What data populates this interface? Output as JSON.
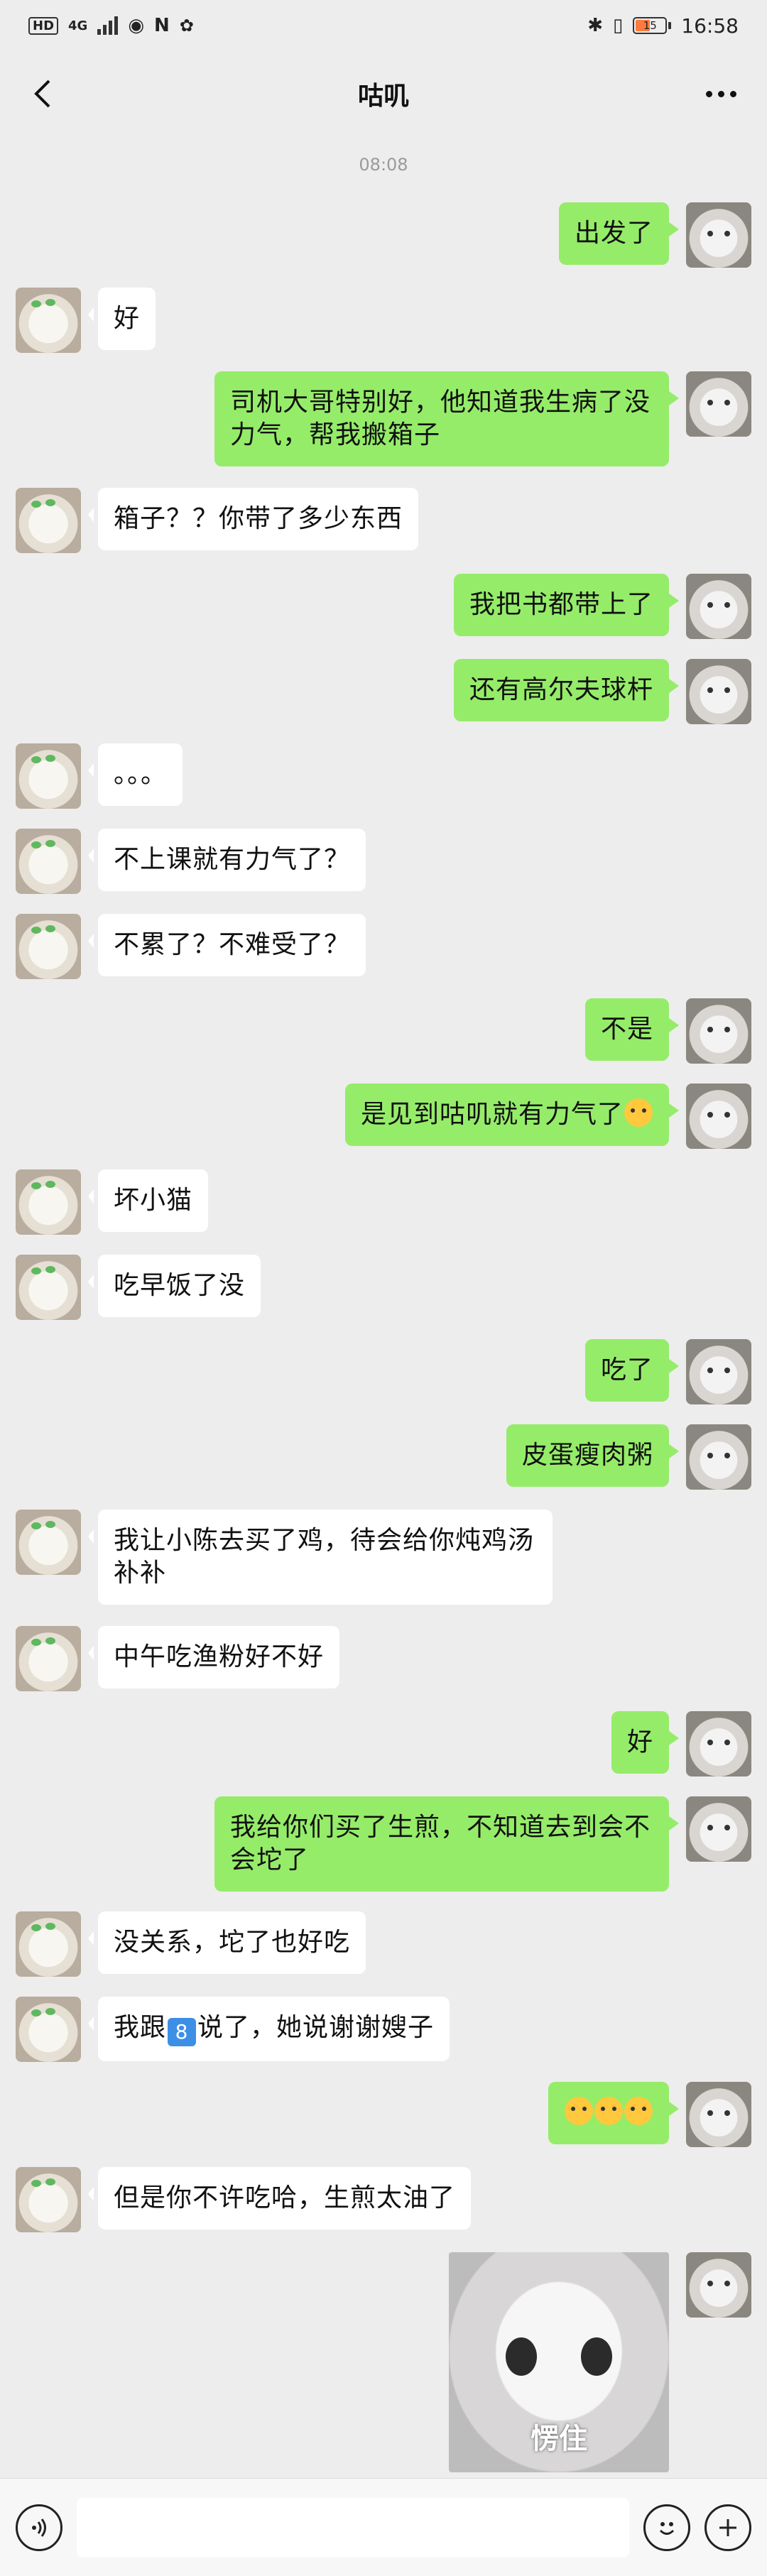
{
  "status_bar": {
    "network": "HD",
    "signal_label": "4G",
    "time": "16:58",
    "battery": "15"
  },
  "header": {
    "back_icon": "chevron-left-icon",
    "title": "咕叽",
    "more_icon": "more-dots-icon"
  },
  "timestamp": "08:08",
  "messages": [
    {
      "from": "self",
      "text": "出发了"
    },
    {
      "from": "other",
      "text": "好"
    },
    {
      "from": "self",
      "text": "司机大哥特别好，他知道我生病了没力气，帮我搬箱子"
    },
    {
      "from": "other",
      "text": "箱子？？你带了多少东西"
    },
    {
      "from": "self",
      "text": "我把书都带上了"
    },
    {
      "from": "self",
      "text": "还有高尔夫球杆"
    },
    {
      "from": "other",
      "text": "。。。"
    },
    {
      "from": "other",
      "text": "不上课就有力气了？"
    },
    {
      "from": "other",
      "text": "不累了？不难受了？"
    },
    {
      "from": "self",
      "text": "不是"
    },
    {
      "from": "self",
      "text": "是见到咕叽就有力气了"
    },
    {
      "from": "other",
      "text": "坏小猫"
    },
    {
      "from": "other",
      "text": "吃早饭了没"
    },
    {
      "from": "self",
      "text": "吃了"
    },
    {
      "from": "self",
      "text": "皮蛋瘦肉粥"
    },
    {
      "from": "other",
      "text": "我让小陈去买了鸡，待会给你炖鸡汤补补"
    },
    {
      "from": "other",
      "text": "中午吃渔粉好不好"
    },
    {
      "from": "self",
      "text": "好"
    },
    {
      "from": "self",
      "text": "我给你们买了生煎，不知道去到会不会坨了"
    },
    {
      "from": "other",
      "text": "没关系，坨了也好吃"
    },
    {
      "from": "other",
      "text_a": "我跟",
      "badge": "8",
      "text_b": "说了，她说谢谢嫂子"
    },
    {
      "from": "self",
      "emoji": "cat-face-emoji ×3"
    },
    {
      "from": "other",
      "text": "但是你不许吃哈，生煎太油了"
    },
    {
      "from": "self",
      "sticker_caption": "愣住"
    }
  ],
  "input_bar": {
    "voice_icon": "voice-icon",
    "emoji_icon": "emoji-icon",
    "plus_icon": "plus-icon",
    "placeholder": ""
  }
}
